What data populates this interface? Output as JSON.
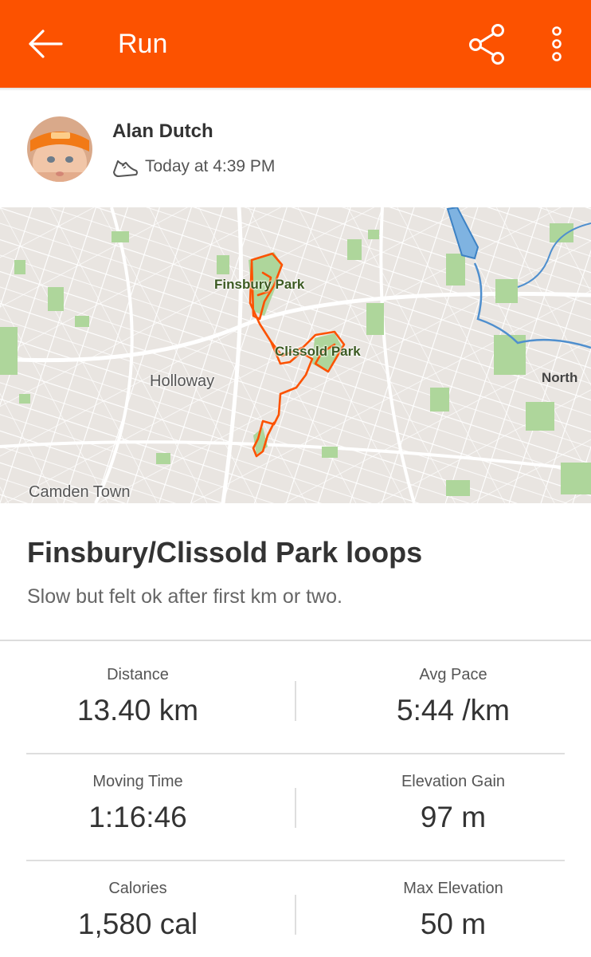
{
  "app_bar": {
    "title": "Run",
    "background": "#fc5200",
    "icons": [
      "arrow-left-icon",
      "share-icon",
      "more-vertical-icon"
    ]
  },
  "activity": {
    "athlete_name": "Alan Dutch",
    "activity_icon": "shoe-icon",
    "timestamp": "Today at 4:39 PM",
    "title": "Finsbury/Clissold Park loops",
    "description": "Slow but felt ok after first km or two."
  },
  "map": {
    "labels": {
      "finsbury_park": "Finsbury Park",
      "clissold_park": "Clissold Park",
      "holloway": "Holloway",
      "camden_town": "Camden Town",
      "north": "North"
    },
    "route_color": "#fc5200"
  },
  "stats": [
    {
      "label": "Distance",
      "value": "13.40 km"
    },
    {
      "label": "Avg Pace",
      "value": "5:44 /km"
    },
    {
      "label": "Moving Time",
      "value": "1:16:46"
    },
    {
      "label": "Elevation Gain",
      "value": "97 m"
    },
    {
      "label": "Calories",
      "value": "1,580 cal"
    },
    {
      "label": "Max Elevation",
      "value": "50 m"
    }
  ]
}
